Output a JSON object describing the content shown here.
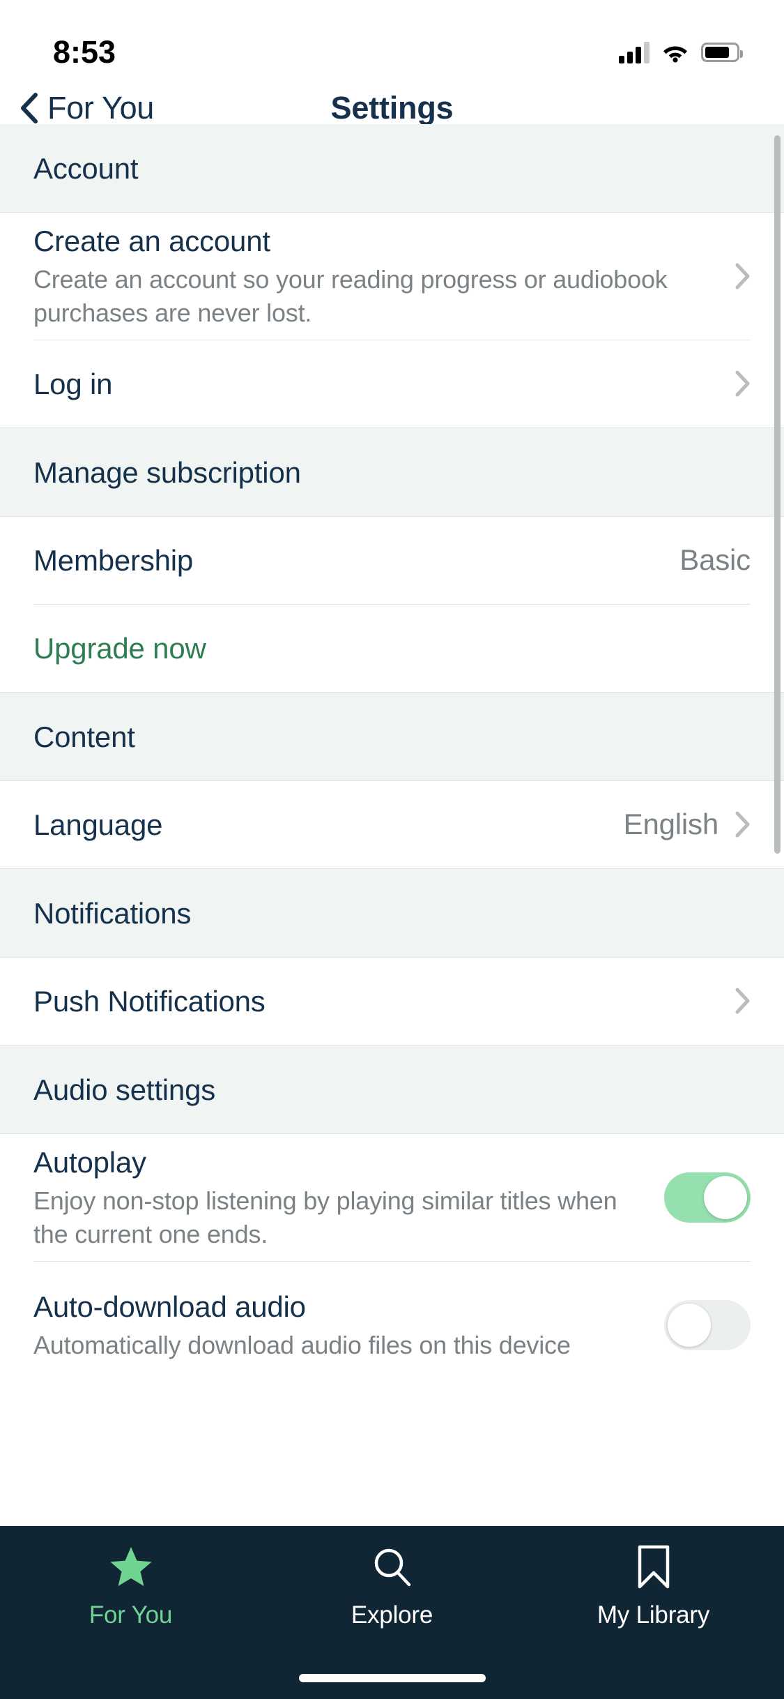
{
  "status_bar": {
    "time": "8:53",
    "cellular_icon": "cellular-bars-icon",
    "wifi_icon": "wifi-icon",
    "battery_icon": "battery-icon"
  },
  "nav": {
    "back_label": "For You",
    "back_icon": "chevron-left-icon",
    "title": "Settings"
  },
  "sections": [
    {
      "header": "Account",
      "rows": [
        {
          "title": "Create an account",
          "subtitle": "Create an account so your reading progress or audiobook purchases are never lost.",
          "accessory": "chevron-right-icon"
        },
        {
          "title": "Log in",
          "accessory": "chevron-right-icon"
        }
      ]
    },
    {
      "header": "Manage subscription",
      "rows": [
        {
          "title": "Membership",
          "value": "Basic"
        },
        {
          "title": "Upgrade now",
          "style": "green-link"
        }
      ]
    },
    {
      "header": "Content",
      "rows": [
        {
          "title": "Language",
          "value": "English",
          "accessory": "chevron-right-icon"
        }
      ]
    },
    {
      "header": "Notifications",
      "rows": [
        {
          "title": "Push Notifications",
          "accessory": "chevron-right-icon"
        }
      ]
    },
    {
      "header": "Audio settings",
      "rows": [
        {
          "title": "Autoplay",
          "subtitle": "Enjoy non-stop listening by playing similar titles when the current one ends.",
          "toggle": "on"
        },
        {
          "title": "Auto-download audio",
          "subtitle": "Automatically download audio files on this device",
          "toggle": "off"
        }
      ]
    }
  ],
  "tabbar": {
    "tabs": [
      {
        "label": "For You",
        "icon": "star-icon",
        "active": true
      },
      {
        "label": "Explore",
        "icon": "search-icon",
        "active": false
      },
      {
        "label": "My Library",
        "icon": "bookmark-icon",
        "active": false
      }
    ]
  },
  "colors": {
    "navy": "#15314b",
    "green_accent": "#2e7d53",
    "toggle_on": "#95e0ae",
    "tabbar_bg": "#112634",
    "tab_active": "#6fd491",
    "section_bg": "#f0f4f3",
    "muted_text": "#7b8285"
  }
}
